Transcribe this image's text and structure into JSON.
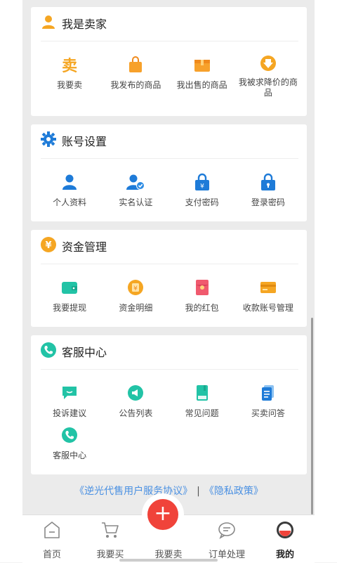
{
  "sections": [
    {
      "title": "我是卖家",
      "icon": "user-orange-icon",
      "items": [
        {
          "label": "我要卖",
          "icon": "sell-text-icon"
        },
        {
          "label": "我发布的商品",
          "icon": "shopping-bag-icon"
        },
        {
          "label": "我出售的商品",
          "icon": "box-icon"
        },
        {
          "label": "我被求降价的商品",
          "icon": "down-arrow-badge-icon"
        }
      ]
    },
    {
      "title": "账号设置",
      "icon": "gear-icon",
      "items": [
        {
          "label": "个人资料",
          "icon": "person-icon"
        },
        {
          "label": "实名认证",
          "icon": "verified-person-icon"
        },
        {
          "label": "支付密码",
          "icon": "payment-lock-icon"
        },
        {
          "label": "登录密码",
          "icon": "login-lock-icon"
        }
      ]
    },
    {
      "title": "资金管理",
      "icon": "yen-coin-icon",
      "items": [
        {
          "label": "我要提现",
          "icon": "wallet-icon"
        },
        {
          "label": "资金明细",
          "icon": "coin-detail-icon"
        },
        {
          "label": "我的红包",
          "icon": "red-packet-icon"
        },
        {
          "label": "收款账号管理",
          "icon": "card-icon"
        }
      ]
    },
    {
      "title": "客服中心",
      "icon": "phone-circle-icon",
      "items": [
        {
          "label": "投诉建议",
          "icon": "chat-bubble-icon"
        },
        {
          "label": "公告列表",
          "icon": "megaphone-icon"
        },
        {
          "label": "常见问题",
          "icon": "book-icon"
        },
        {
          "label": "买卖问答",
          "icon": "document-icon"
        },
        {
          "label": "客服中心",
          "icon": "phone-icon"
        }
      ]
    }
  ],
  "footer": {
    "agreement": "《逆光代售用户服务协议》",
    "separator": "|",
    "privacy": "《隐私政策》"
  },
  "tabbar": {
    "items": [
      {
        "label": "首页",
        "icon": "home-icon"
      },
      {
        "label": "我要买",
        "icon": "cart-icon"
      },
      {
        "label": "我要卖",
        "icon": "plus-icon"
      },
      {
        "label": "订单处理",
        "icon": "message-icon"
      },
      {
        "label": "我的",
        "icon": "profile-avatar-icon"
      }
    ],
    "active": "我的",
    "sell_symbol": "+"
  },
  "colors": {
    "accent_orange": "#f5a623",
    "accent_blue": "#1e7bd8",
    "accent_teal": "#22c3a6",
    "sell_red": "#f0433a",
    "link_blue": "#4a90e2"
  }
}
